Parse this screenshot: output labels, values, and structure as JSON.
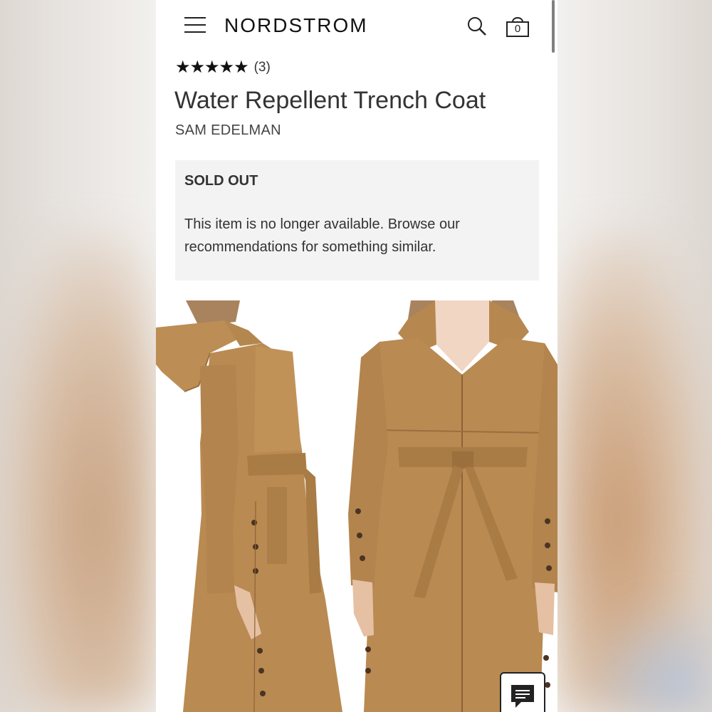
{
  "header": {
    "logo": "NORDSTROM",
    "bag_count": "0"
  },
  "product": {
    "stars": "★★★★★",
    "rating": 5,
    "review_count": "(3)",
    "title": "Water Repellent Trench Coat",
    "brand": "SAM EDELMAN"
  },
  "availability": {
    "status": "SOLD OUT",
    "message": "This item is no longer available. Browse our recommendations for something similar."
  },
  "colors": {
    "coat": "#b98a52",
    "text": "#333333",
    "notice_bg": "#f3f3f3"
  }
}
